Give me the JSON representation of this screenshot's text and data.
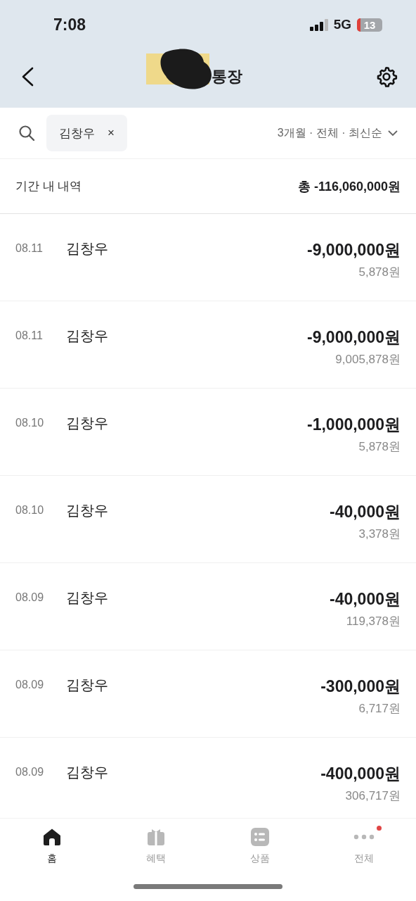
{
  "status_bar": {
    "time": "7:08",
    "network": "5G",
    "battery": "13"
  },
  "header": {
    "title": "통장"
  },
  "filter": {
    "chip": "김창우",
    "chip_close": "×",
    "options": "3개월 · 전체 · 최신순"
  },
  "summary": {
    "label": "기간 내 내역",
    "total": "총 -116,060,000원"
  },
  "transactions": [
    {
      "date": "08.11",
      "name": "김창우",
      "amount": "-9,000,000원",
      "balance": "5,878원"
    },
    {
      "date": "08.11",
      "name": "김창우",
      "amount": "-9,000,000원",
      "balance": "9,005,878원"
    },
    {
      "date": "08.10",
      "name": "김창우",
      "amount": "-1,000,000원",
      "balance": "5,878원"
    },
    {
      "date": "08.10",
      "name": "김창우",
      "amount": "-40,000원",
      "balance": "3,378원"
    },
    {
      "date": "08.09",
      "name": "김창우",
      "amount": "-40,000원",
      "balance": "119,378원"
    },
    {
      "date": "08.09",
      "name": "김창우",
      "amount": "-300,000원",
      "balance": "6,717원"
    },
    {
      "date": "08.09",
      "name": "김창우",
      "amount": "-400,000원",
      "balance": "306,717원"
    }
  ],
  "nav": [
    {
      "kind": "home",
      "label": "홈",
      "selected": true,
      "badge": false
    },
    {
      "kind": "gift",
      "label": "혜택",
      "selected": false,
      "badge": false
    },
    {
      "kind": "list",
      "label": "상품",
      "selected": false,
      "badge": false
    },
    {
      "kind": "more",
      "label": "전체",
      "selected": false,
      "badge": true
    }
  ]
}
